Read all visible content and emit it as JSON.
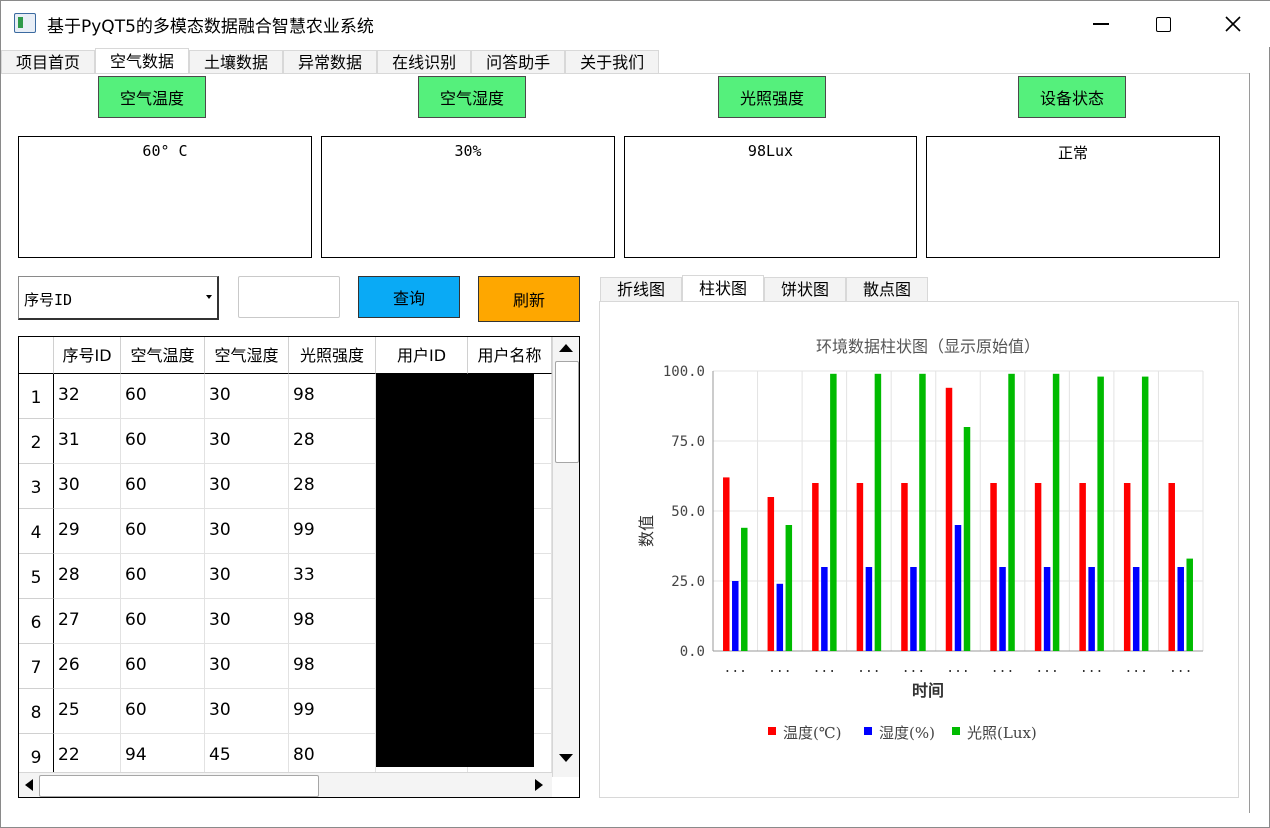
{
  "window": {
    "title": "基于PyQT5的多模态数据融合智慧农业系统",
    "icon": "app-window-icon",
    "controls": {
      "minimize": "minimize-icon",
      "maximize": "maximize-icon",
      "close": "close-icon"
    }
  },
  "tabs": [
    {
      "label": "项目首页",
      "active": false
    },
    {
      "label": "空气数据",
      "active": true
    },
    {
      "label": "土壤数据",
      "active": false
    },
    {
      "label": "异常数据",
      "active": false
    },
    {
      "label": "在线识别",
      "active": false
    },
    {
      "label": "问答助手",
      "active": false
    },
    {
      "label": "关于我们",
      "active": false
    }
  ],
  "cards": [
    {
      "label": "空气温度",
      "value": "60° C"
    },
    {
      "label": "空气湿度",
      "value": "30%"
    },
    {
      "label": "光照强度",
      "value": "98Lux"
    },
    {
      "label": "设备状态",
      "value": "正常"
    }
  ],
  "controls": {
    "combo_value": "序号ID",
    "search_value": "",
    "query_label": "查询",
    "refresh_label": "刷新"
  },
  "colors": {
    "label_green": "#55f07c",
    "query_blue": "#0aaaf5",
    "refresh_orange": "#fea700"
  },
  "table": {
    "columns": [
      "序号ID",
      "空气温度",
      "空气湿度",
      "光照强度",
      "用户ID",
      "用户名称"
    ],
    "row_numbers": [
      "1",
      "2",
      "3",
      "4",
      "5",
      "6",
      "7",
      "8",
      "9"
    ],
    "rows": [
      [
        "32",
        "60",
        "30",
        "98"
      ],
      [
        "31",
        "60",
        "30",
        "28"
      ],
      [
        "30",
        "60",
        "30",
        "28"
      ],
      [
        "29",
        "60",
        "30",
        "99"
      ],
      [
        "28",
        "60",
        "30",
        "33"
      ],
      [
        "27",
        "60",
        "30",
        "98"
      ],
      [
        "26",
        "60",
        "30",
        "98"
      ],
      [
        "25",
        "60",
        "30",
        "99"
      ],
      [
        "22",
        "94",
        "45",
        "80"
      ]
    ]
  },
  "chart_tabs": [
    {
      "label": "折线图",
      "active": false
    },
    {
      "label": "柱状图",
      "active": true
    },
    {
      "label": "饼状图",
      "active": false
    },
    {
      "label": "散点图",
      "active": false
    }
  ],
  "chart_data": {
    "type": "bar",
    "title": "环境数据柱状图（显示原始值）",
    "xlabel": "时间",
    "ylabel": "数值",
    "ylim": [
      0,
      100
    ],
    "yticks": [
      "0.0",
      "25.0",
      "50.0",
      "75.0",
      "100.0"
    ],
    "categories": [
      "...",
      "...",
      "...",
      "...",
      "...",
      "...",
      "...",
      "...",
      "...",
      "...",
      "..."
    ],
    "series": [
      {
        "name": "温度(℃)",
        "color": "#ff0000",
        "values": [
          62,
          55,
          60,
          60,
          60,
          94,
          60,
          60,
          60,
          60,
          60
        ]
      },
      {
        "name": "湿度(%)",
        "color": "#0000ff",
        "values": [
          25,
          24,
          30,
          30,
          30,
          45,
          30,
          30,
          30,
          30,
          30
        ]
      },
      {
        "name": "光照(Lux)",
        "color": "#00bb00",
        "values": [
          44,
          45,
          99,
          99,
          99,
          80,
          99,
          99,
          98,
          98,
          33
        ]
      }
    ],
    "grid": true,
    "legend": "bottom"
  }
}
